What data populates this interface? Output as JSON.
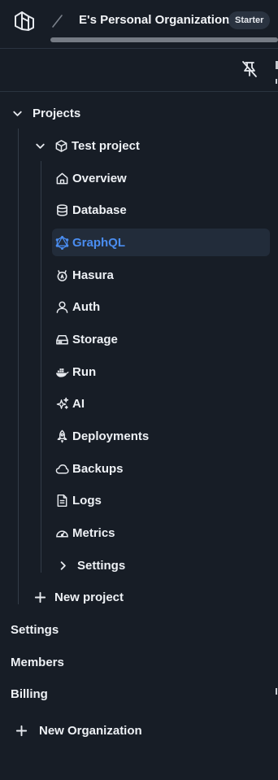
{
  "header": {
    "org_name": "E's Personal Organization",
    "plan_badge": "Starter"
  },
  "icons": {
    "logo": "nhost-logo-icon",
    "separator": "slash-icon",
    "pin": "unpin-icon"
  },
  "tree": {
    "projects_label": "Projects",
    "project": {
      "name": "Test project",
      "items": [
        {
          "label": "Overview",
          "icon": "home-icon"
        },
        {
          "label": "Database",
          "icon": "database-icon"
        },
        {
          "label": "GraphQL",
          "icon": "graphql-icon",
          "active": true
        },
        {
          "label": "Hasura",
          "icon": "hasura-icon"
        },
        {
          "label": "Auth",
          "icon": "user-icon"
        },
        {
          "label": "Storage",
          "icon": "hard-drive-icon"
        },
        {
          "label": "Run",
          "icon": "docker-icon"
        },
        {
          "label": "AI",
          "icon": "sparkles-icon"
        },
        {
          "label": "Deployments",
          "icon": "rocket-icon"
        },
        {
          "label": "Backups",
          "icon": "cloud-icon"
        },
        {
          "label": "Logs",
          "icon": "file-text-icon"
        },
        {
          "label": "Metrics",
          "icon": "gauge-icon"
        }
      ],
      "settings_label": "Settings"
    },
    "new_project_label": "New project"
  },
  "org_links": {
    "settings": "Settings",
    "members": "Members",
    "billing": "Billing"
  },
  "new_org_label": "New Organization",
  "colors": {
    "background": "#171d26",
    "active_bg": "#222c3a",
    "accent": "#4a8df0",
    "text": "#eef1f5"
  }
}
